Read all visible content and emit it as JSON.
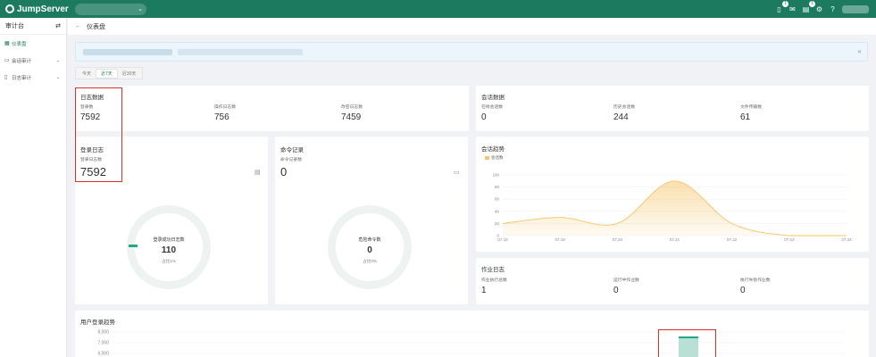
{
  "topbar": {
    "brand": "JumpServer",
    "org_chevron": "⌄",
    "badge1": "1",
    "badge2": "1"
  },
  "sidebar": {
    "title": "审计台",
    "items": [
      {
        "label": "仪表盘",
        "icon": "dashboard-icon"
      },
      {
        "label": "会话审计",
        "icon": "session-icon"
      },
      {
        "label": "日志审计",
        "icon": "log-icon"
      }
    ]
  },
  "breadcrumb": {
    "title": "仪表盘"
  },
  "tabs": [
    "今天",
    "近7天",
    "近30天"
  ],
  "log_data": {
    "title": "日志数据",
    "stats": [
      {
        "label": "登录数",
        "value": "7592"
      },
      {
        "label": "操作日志数",
        "value": "756"
      },
      {
        "label": "改密日志数",
        "value": "7459"
      }
    ]
  },
  "session_data": {
    "title": "会话数据",
    "stats": [
      {
        "label": "在线会话数",
        "value": "0"
      },
      {
        "label": "历史会话数",
        "value": "244"
      },
      {
        "label": "文件传输数",
        "value": "61"
      }
    ]
  },
  "login_log": {
    "title": "登录日志",
    "label": "登录日志数",
    "value": "7592",
    "donut_label": "登录成功日志数",
    "donut_value": "110",
    "donut_sub": "占比1%",
    "donut_fraction": 0.01
  },
  "command_log": {
    "title": "命令记录",
    "label": "命令记录数",
    "value": "0",
    "donut_label": "危险命令数",
    "donut_value": "0",
    "donut_sub": "占比0%"
  },
  "session_trend": {
    "title": "会话趋势",
    "legend": "会话数"
  },
  "job_log": {
    "title": "作业日志",
    "stats": [
      {
        "label": "作业执行总数",
        "value": "1"
      },
      {
        "label": "运行中作业数",
        "value": "0"
      },
      {
        "label": "执行失败作业数",
        "value": "0"
      }
    ]
  },
  "user_login_trend": {
    "title": "用户登录趋势"
  },
  "chart_data": [
    {
      "type": "area",
      "title": "会话趋势",
      "series": [
        {
          "name": "会话数",
          "values": [
            20,
            30,
            20,
            90,
            20,
            0,
            0
          ]
        }
      ],
      "categories": [
        "07.18",
        "07.19",
        "07.20",
        "07.21",
        "07.22",
        "07.23",
        "07.24"
      ],
      "ylim": [
        0,
        100
      ],
      "yticks": [
        "100",
        "80",
        "60",
        "40",
        "20",
        "0"
      ]
    },
    {
      "type": "bar",
      "title": "用户登录趋势",
      "yticks": [
        "8,000",
        "7,000",
        "6,000"
      ]
    }
  ],
  "colors": {
    "brand": "#1c7a5e",
    "area": "#f5c56a",
    "highlight": "#d9302c"
  }
}
